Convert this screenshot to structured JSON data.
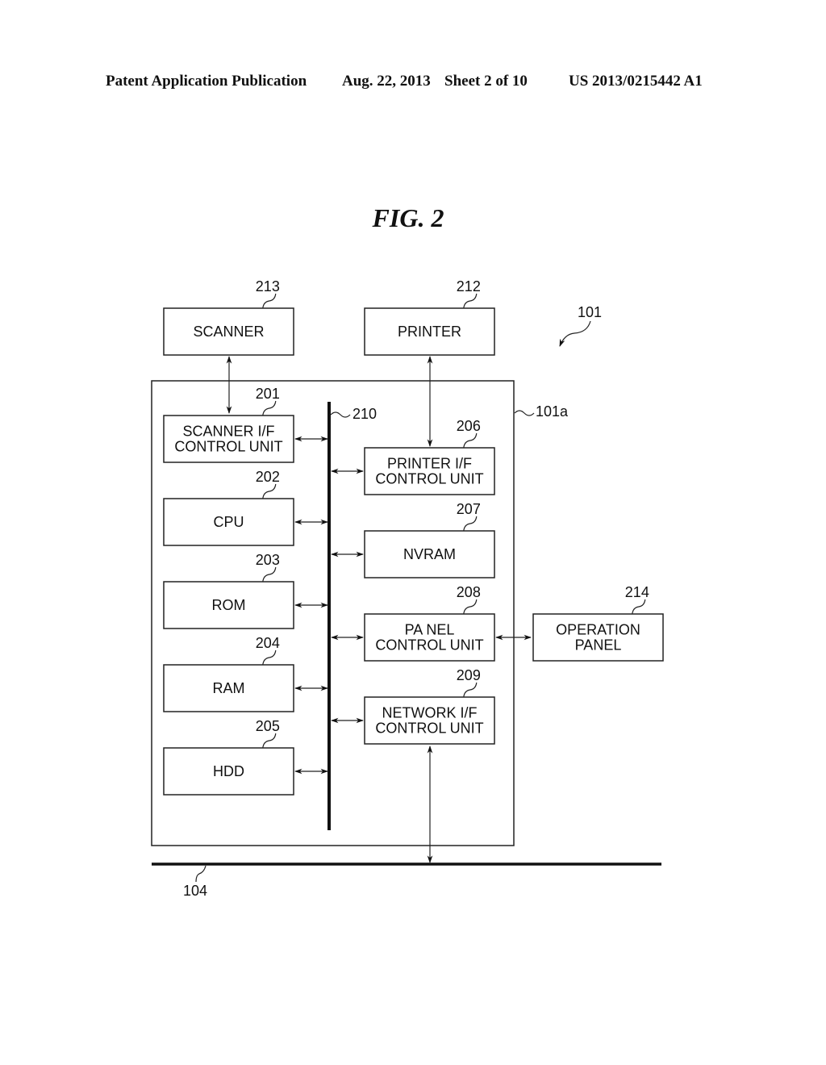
{
  "header": {
    "left": "Patent Application Publication",
    "date": "Aug. 22, 2013",
    "sheet": "Sheet 2 of 10",
    "number": "US 2013/0215442 A1"
  },
  "figure": {
    "title": "FIG. 2",
    "system_ref": "101",
    "controller_ref": "101a",
    "bus_ref": "210",
    "network_ref": "104",
    "external": [
      {
        "id": "scanner",
        "ref": "213",
        "lines": [
          "SCANNER"
        ]
      },
      {
        "id": "printer",
        "ref": "212",
        "lines": [
          "PRINTER"
        ]
      },
      {
        "id": "operation-panel",
        "ref": "214",
        "lines": [
          "OPERATION",
          "PANEL"
        ]
      }
    ],
    "left_column": [
      {
        "id": "scanner-if",
        "ref": "201",
        "lines": [
          "SCANNER I/F",
          "CONTROL UNIT"
        ]
      },
      {
        "id": "cpu",
        "ref": "202",
        "lines": [
          "CPU"
        ]
      },
      {
        "id": "rom",
        "ref": "203",
        "lines": [
          "ROM"
        ]
      },
      {
        "id": "ram",
        "ref": "204",
        "lines": [
          "RAM"
        ]
      },
      {
        "id": "hdd",
        "ref": "205",
        "lines": [
          "HDD"
        ]
      }
    ],
    "right_column": [
      {
        "id": "printer-if",
        "ref": "206",
        "lines": [
          "PRINTER I/F",
          "CONTROL UNIT"
        ]
      },
      {
        "id": "nvram",
        "ref": "207",
        "lines": [
          "NVRAM"
        ]
      },
      {
        "id": "panel-control",
        "ref": "208",
        "lines": [
          "PA NEL",
          "CONTROL UNIT"
        ]
      },
      {
        "id": "network-if",
        "ref": "209",
        "lines": [
          "NETWORK I/F",
          "CONTROL UNIT"
        ]
      }
    ]
  }
}
